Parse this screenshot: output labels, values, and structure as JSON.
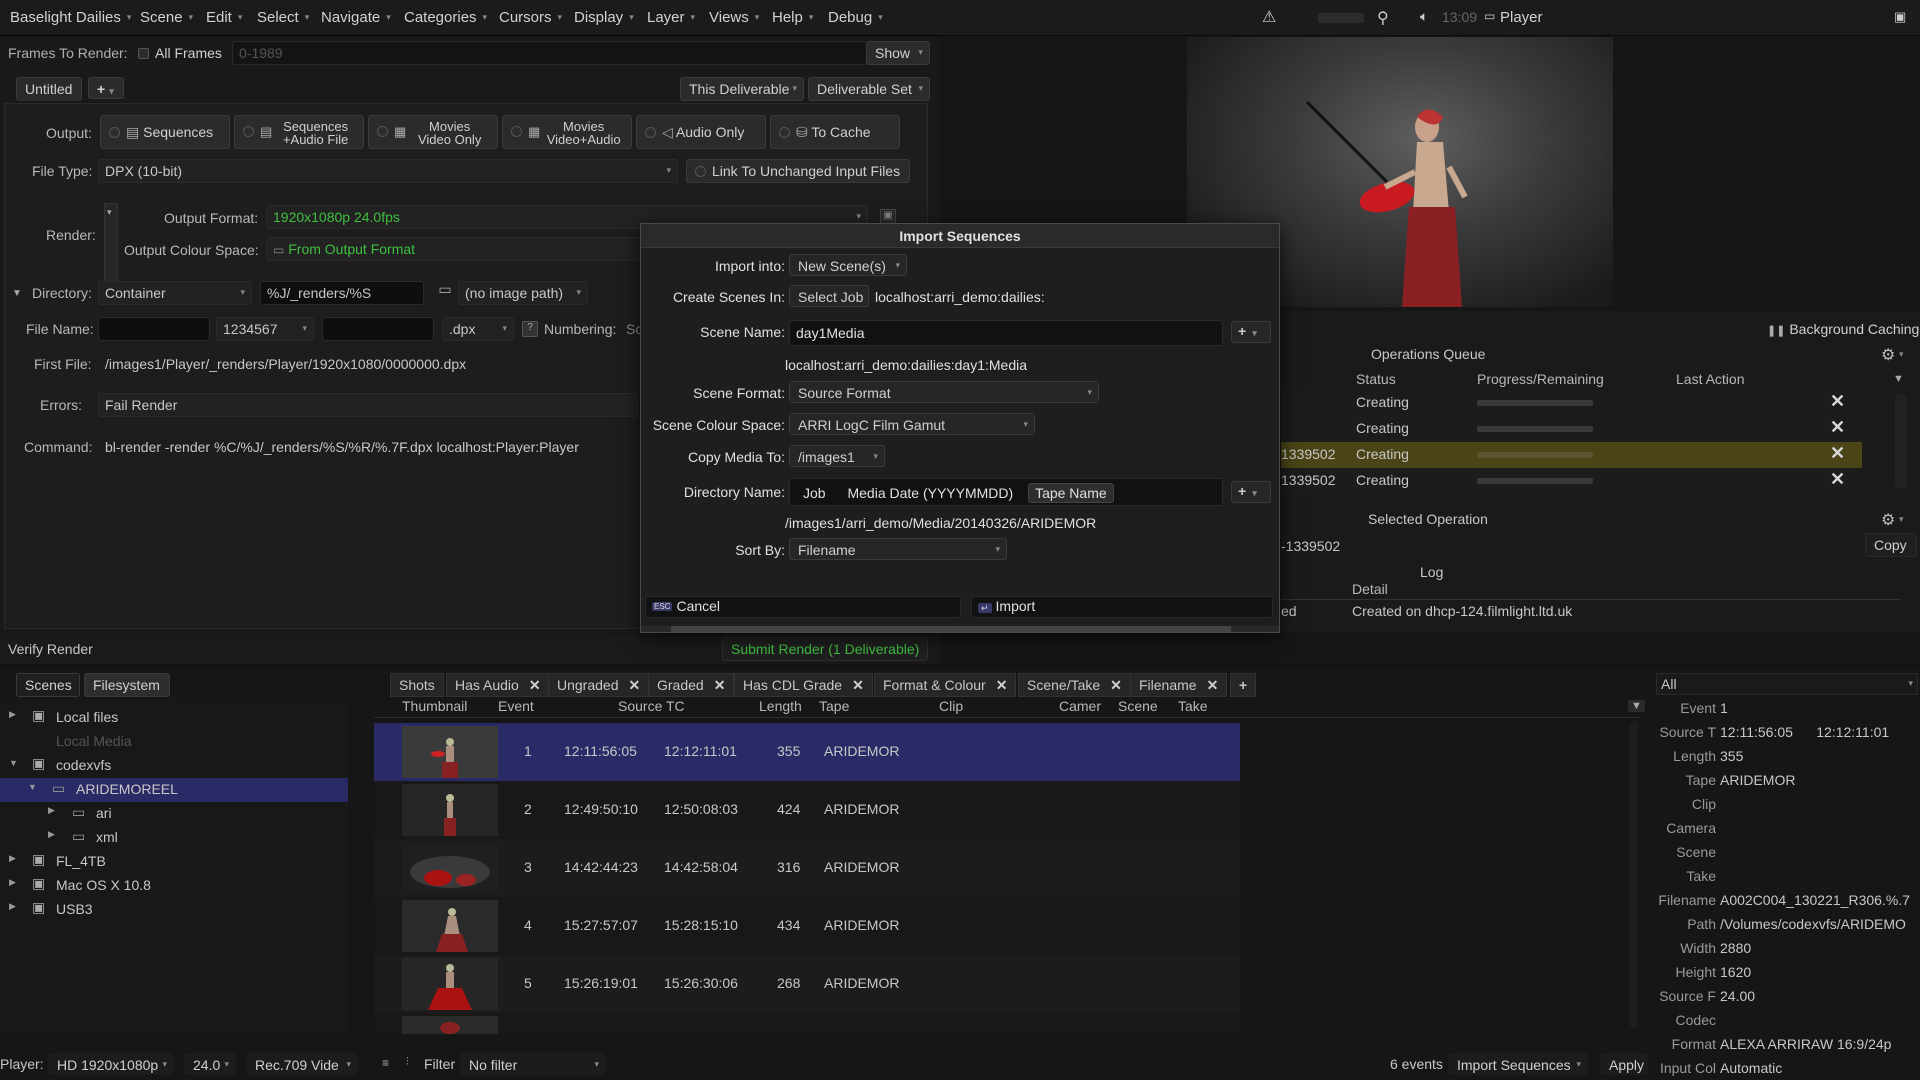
{
  "menubar": {
    "app_menu": "Baselight Dailies",
    "items": [
      "Scene",
      "Edit",
      "Select",
      "Navigate",
      "Categories",
      "Cursors",
      "Display",
      "Layer",
      "Views",
      "Help",
      "Debug"
    ],
    "time": "13:09",
    "player_label": "Player"
  },
  "render": {
    "frames_label": "Frames To Render:",
    "all_frames": "All Frames",
    "frame_range": "0-1989",
    "show_button": "Show",
    "tab_untitled": "Untitled",
    "add_tab": "+",
    "this_deliverable": "This Deliverable",
    "deliverable_set": "Deliverable Set",
    "output_label": "Output:",
    "output_options": [
      {
        "line1": "Sequences",
        "line2": ""
      },
      {
        "line1": "Sequences",
        "line2": "+Audio File"
      },
      {
        "line1": "Movies",
        "line2": "Video Only"
      },
      {
        "line1": "Movies",
        "line2": "Video+Audio"
      },
      {
        "line1": "Audio Only",
        "line2": ""
      },
      {
        "line1": "To Cache",
        "line2": ""
      }
    ],
    "file_type_label": "File Type:",
    "file_type_value": "DPX (10-bit)",
    "link_unchanged": "Link To Unchanged Input Files",
    "render_label": "Render:",
    "output_format_label": "Output Format:",
    "output_format_value": "1920x1080p 24.0fps",
    "output_colour_label": "Output Colour Space:",
    "output_colour_value": "From Output Format",
    "directory_label": "Directory:",
    "directory_type": "Container",
    "directory_path": "%J/_renders/%S",
    "no_image_path": "(no image path)",
    "file_name_label": "File Name:",
    "file_name_number": "1234567",
    "file_ext": ".dpx",
    "numbering_label": "Numbering:",
    "numbering_value": "Sc",
    "first_file_label": "First File:",
    "first_file_value": "/images1/Player/_renders/Player/1920x1080/0000000.dpx",
    "errors_label": "Errors:",
    "errors_value": "Fail Render",
    "command_label": "Command:",
    "command_value": "bl-render -render %C/%J/_renders/%S/%R/%.7F.dpx localhost:Player:Player",
    "verify_render": "Verify Render",
    "submit_render": "Submit Render (1 Deliverable)"
  },
  "dialog": {
    "title": "Import Sequences",
    "import_into_label": "Import into:",
    "import_into_value": "New Scene(s)",
    "create_in_label": "Create Scenes In:",
    "select_job": "Select Job",
    "job_path": "localhost:arri_demo:dailies:",
    "scene_name_label": "Scene Name:",
    "scene_name_value": "day1Media",
    "scene_full_path": "localhost:arri_demo:dailies:day1:Media",
    "scene_format_label": "Scene Format:",
    "scene_format_value": "Source Format",
    "scene_colour_label": "Scene Colour Space:",
    "scene_colour_value": "ARRI LogC Film Gamut",
    "copy_media_label": "Copy Media To:",
    "copy_media_value": "/images1",
    "dir_name_label": "Directory Name:",
    "dir_tags": [
      "Job",
      "Media Date (YYYYMMDD)",
      "Tape Name"
    ],
    "dir_full_path": "/images1/arri_demo/Media/20140326/ARIDEMOR",
    "sort_by_label": "Sort By:",
    "sort_by_value": "Filename",
    "cancel": "Cancel",
    "import": "Import",
    "esc_key": "ESC",
    "plus": "+"
  },
  "ops": {
    "background_caching": "Background Caching",
    "queue_title": "Operations Queue",
    "col_status": "Status",
    "col_progress": "Progress/Remaining",
    "col_last_action": "Last Action",
    "rows": [
      {
        "id": "",
        "status": "Creating",
        "progress": 0
      },
      {
        "id": "",
        "status": "Creating",
        "progress": 0
      },
      {
        "id": "1339502",
        "status": "Creating",
        "progress": 0
      },
      {
        "id": "1339502",
        "status": "Creating",
        "progress": 0
      }
    ],
    "selected_title": "Selected Operation",
    "selected_id": "-1339502",
    "copy": "Copy",
    "log_title": "Log",
    "log_detail_header": "Detail",
    "log_status_partial": "ed",
    "log_detail": "Created on dhcp-124.filmlight.ltd.uk"
  },
  "browser": {
    "tabs": [
      "Scenes",
      "Filesystem"
    ],
    "tree": [
      {
        "label": "Local files",
        "level": 0,
        "arrow": "▶",
        "icon": true
      },
      {
        "label": "Local Media",
        "level": 1,
        "arrow": "",
        "icon": false,
        "dim": true
      },
      {
        "label": "codexvfs",
        "level": 0,
        "arrow": "▼",
        "icon": true
      },
      {
        "label": "ARIDEMOREEL",
        "level": 1,
        "arrow": "▼",
        "icon": true,
        "selected": true
      },
      {
        "label": "ari",
        "level": 2,
        "arrow": "▶",
        "icon": true
      },
      {
        "label": "xml",
        "level": 2,
        "arrow": "▶",
        "icon": true
      },
      {
        "label": "FL_4TB",
        "level": 0,
        "arrow": "▶",
        "icon": true
      },
      {
        "label": "Mac OS X 10.8",
        "level": 0,
        "arrow": "▶",
        "icon": true
      },
      {
        "label": "USB3",
        "level": 0,
        "arrow": "▶",
        "icon": true
      }
    ],
    "filter_tabs": [
      {
        "label": "Shots",
        "close": false
      },
      {
        "label": "Has Audio",
        "close": true
      },
      {
        "label": "Ungraded",
        "close": true
      },
      {
        "label": "Graded",
        "close": true
      },
      {
        "label": "Has CDL Grade",
        "close": true
      },
      {
        "label": "Format & Colour",
        "close": true
      },
      {
        "label": "Scene/Take",
        "close": true
      },
      {
        "label": "Filename",
        "close": true
      }
    ],
    "columns": [
      "Thumbnail",
      "Event",
      "Source TC",
      "Length",
      "Tape",
      "Clip",
      "Camer",
      "Scene",
      "Take"
    ],
    "rows": [
      {
        "event": "1",
        "tc_in": "12:11:56:05",
        "tc_out": "12:12:11:01",
        "length": "355",
        "tape": "ARIDEMOR"
      },
      {
        "event": "2",
        "tc_in": "12:49:50:10",
        "tc_out": "12:50:08:03",
        "length": "424",
        "tape": "ARIDEMOR"
      },
      {
        "event": "3",
        "tc_in": "14:42:44:23",
        "tc_out": "14:42:58:04",
        "length": "316",
        "tape": "ARIDEMOR"
      },
      {
        "event": "4",
        "tc_in": "15:27:57:07",
        "tc_out": "15:28:15:10",
        "length": "434",
        "tape": "ARIDEMOR"
      },
      {
        "event": "5",
        "tc_in": "15:26:19:01",
        "tc_out": "15:26:30:06",
        "length": "268",
        "tape": "ARIDEMOR"
      }
    ],
    "events_count": "6 events",
    "import_mode": "Import Sequences",
    "apply": "Apply",
    "filter_label": "Filter",
    "filter_value": "No filter"
  },
  "info": {
    "all": "All",
    "fields": [
      {
        "label": "Event",
        "value": "1"
      },
      {
        "label": "Source T",
        "value": "12:11:56:05      12:12:11:01"
      },
      {
        "label": "Length",
        "value": "355"
      },
      {
        "label": "Tape",
        "value": "ARIDEMOR"
      },
      {
        "label": "Clip",
        "value": ""
      },
      {
        "label": "Camera",
        "value": ""
      },
      {
        "label": "Scene",
        "value": ""
      },
      {
        "label": "Take",
        "value": ""
      },
      {
        "label": "Filename",
        "value": "A002C004_130221_R306.%.7"
      },
      {
        "label": "Path",
        "value": "/Volumes/codexvfs/ARIDEMO"
      },
      {
        "label": "Width",
        "value": "2880"
      },
      {
        "label": "Height",
        "value": "1620"
      },
      {
        "label": "Source F",
        "value": "24.00"
      },
      {
        "label": "Codec",
        "value": ""
      },
      {
        "label": "Format",
        "value": "ALEXA ARRIRAW 16:9/24p"
      },
      {
        "label": "Input Col",
        "value": "Automatic"
      }
    ]
  },
  "statusbar": {
    "player_label": "Player:",
    "player_format": "HD 1920x1080p",
    "fps": "24.0",
    "colour": "Rec.709 Vide"
  },
  "colors": {
    "accent_green": "#3fbf3f",
    "selection": "#2a2a66",
    "highlight_row": "#4a4416"
  }
}
